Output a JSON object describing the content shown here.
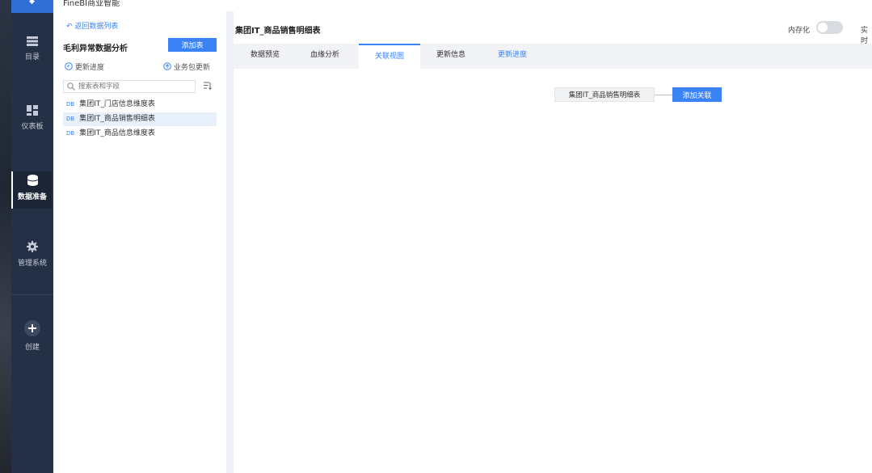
{
  "app": {
    "title": "FineBI商业智能"
  },
  "nav": {
    "items": [
      {
        "label": "目录",
        "icon": "list-icon"
      },
      {
        "label": "仪表板",
        "icon": "dashboard-icon"
      },
      {
        "label": "数据准备",
        "icon": "database-icon",
        "active": true
      },
      {
        "label": "管理系统",
        "icon": "gear-icon"
      },
      {
        "label": "创建",
        "icon": "plus-icon"
      }
    ]
  },
  "left_panel": {
    "back_link": "返回数据列表",
    "project_title": "毛利异常数据分析",
    "add_table_label": "添加表",
    "update_progress": "更新进度",
    "package_update": "业务包更新",
    "search_placeholder": "搜索表和字段",
    "tables": [
      {
        "name": "集团IT_门店信息维度表",
        "selected": false
      },
      {
        "name": "集团IT_商品销售明细表",
        "selected": true
      },
      {
        "name": "集团IT_商品信息维度表",
        "selected": false
      }
    ]
  },
  "main": {
    "title": "集团IT_商品销售明细表",
    "memory_label": "内存化",
    "memory_enabled": false,
    "realtime_label": "实时",
    "tabs": [
      {
        "label": "数据预览"
      },
      {
        "label": "血缘分析"
      },
      {
        "label": "关联视图",
        "active": true
      },
      {
        "label": "更新信息"
      },
      {
        "label": "更新进度"
      }
    ],
    "relation": {
      "node_label": "集团IT_商品销售明细表",
      "add_relation_label": "添加关联"
    }
  },
  "colors": {
    "accent": "#3b83f5",
    "nav_bg": "#243045",
    "selected_row": "#e8f0fc"
  }
}
